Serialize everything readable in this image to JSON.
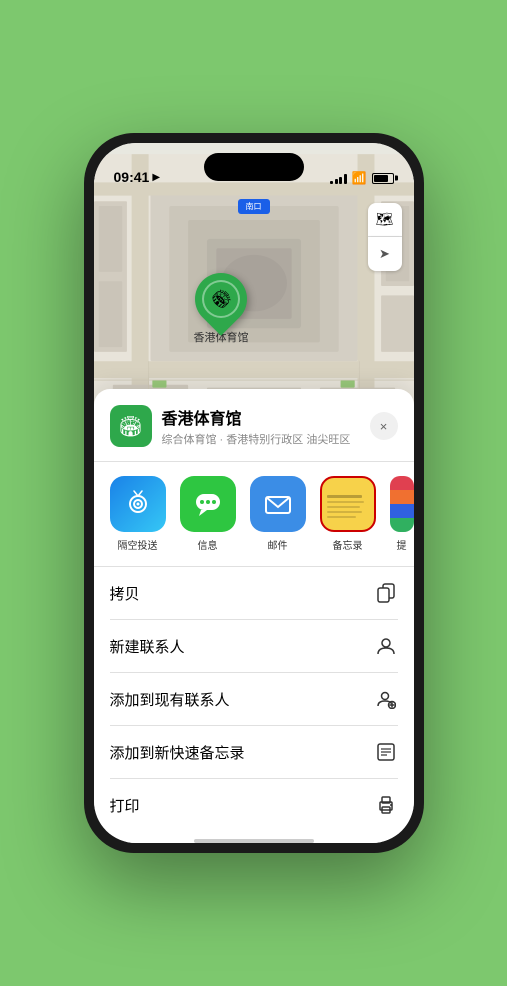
{
  "status_bar": {
    "time": "09:41",
    "location_arrow": "▶"
  },
  "map": {
    "nav_label": "南口",
    "controls": {
      "map_type_icon": "🗺",
      "location_icon": "➤"
    }
  },
  "pin": {
    "label": "香港体育馆"
  },
  "sheet": {
    "venue_name": "香港体育馆",
    "venue_subtitle": "综合体育馆 · 香港特别行政区 油尖旺区",
    "close_label": "×"
  },
  "share_apps": [
    {
      "id": "airdrop",
      "label": "隔空投送"
    },
    {
      "id": "messages",
      "label": "信息"
    },
    {
      "id": "mail",
      "label": "邮件"
    },
    {
      "id": "notes",
      "label": "备忘录",
      "selected": true
    },
    {
      "id": "more",
      "label": "提"
    }
  ],
  "actions": [
    {
      "id": "copy",
      "label": "拷贝",
      "icon": "copy"
    },
    {
      "id": "new-contact",
      "label": "新建联系人",
      "icon": "person"
    },
    {
      "id": "add-existing",
      "label": "添加到现有联系人",
      "icon": "person-add"
    },
    {
      "id": "add-note",
      "label": "添加到新快速备忘录",
      "icon": "note"
    },
    {
      "id": "print",
      "label": "打印",
      "icon": "printer"
    }
  ]
}
